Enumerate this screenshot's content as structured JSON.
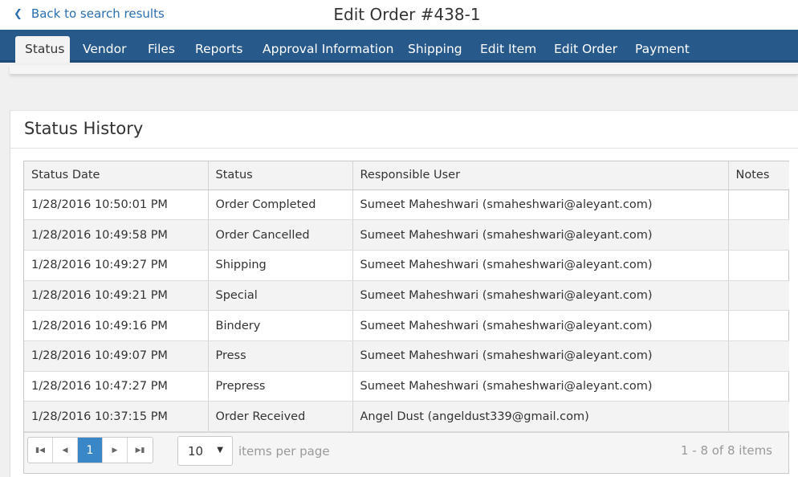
{
  "header": {
    "back_label": "Back to search results",
    "title": "Edit Order #438-1"
  },
  "tabs": [
    {
      "label": "Status",
      "active": true
    },
    {
      "label": "Vendor"
    },
    {
      "label": "Files"
    },
    {
      "label": "Reports"
    },
    {
      "label": "Approval Information"
    },
    {
      "label": "Shipping"
    },
    {
      "label": "Edit Item"
    },
    {
      "label": "Edit Order"
    },
    {
      "label": "Payment"
    }
  ],
  "panel": {
    "title": "Status History"
  },
  "table": {
    "columns": [
      "Status Date",
      "Status",
      "Responsible User",
      "Notes"
    ],
    "rows": [
      {
        "date": "1/28/2016 10:50:01 PM",
        "status": "Order Completed",
        "user": "Sumeet Maheshwari (smaheshwari@aleyant.com)",
        "notes": ""
      },
      {
        "date": "1/28/2016 10:49:58 PM",
        "status": "Order Cancelled",
        "user": "Sumeet Maheshwari (smaheshwari@aleyant.com)",
        "notes": ""
      },
      {
        "date": "1/28/2016 10:49:27 PM",
        "status": "Shipping",
        "user": "Sumeet Maheshwari (smaheshwari@aleyant.com)",
        "notes": ""
      },
      {
        "date": "1/28/2016 10:49:21 PM",
        "status": "Special",
        "user": "Sumeet Maheshwari (smaheshwari@aleyant.com)",
        "notes": ""
      },
      {
        "date": "1/28/2016 10:49:16 PM",
        "status": "Bindery",
        "user": "Sumeet Maheshwari (smaheshwari@aleyant.com)",
        "notes": ""
      },
      {
        "date": "1/28/2016 10:49:07 PM",
        "status": "Press",
        "user": "Sumeet Maheshwari (smaheshwari@aleyant.com)",
        "notes": ""
      },
      {
        "date": "1/28/2016 10:47:27 PM",
        "status": "Prepress",
        "user": "Sumeet Maheshwari (smaheshwari@aleyant.com)",
        "notes": ""
      },
      {
        "date": "1/28/2016 10:37:15 PM",
        "status": "Order Received",
        "user": "Angel Dust (angeldust339@gmail.com)",
        "notes": ""
      }
    ]
  },
  "pager": {
    "current_page": "1",
    "page_size": "10",
    "items_per_page_label": "items per page",
    "range_label": "1 - 8 of 8 items"
  },
  "icons": {
    "back": "chevron-left-icon",
    "first": "first-page-icon",
    "prev": "prev-page-icon",
    "next": "next-page-icon",
    "last": "last-page-icon",
    "dropdown": "dropdown-arrow-icon"
  },
  "colors": {
    "nav_bar": "#28598b",
    "link": "#2a6fb0",
    "current_page": "#3a87c8"
  }
}
